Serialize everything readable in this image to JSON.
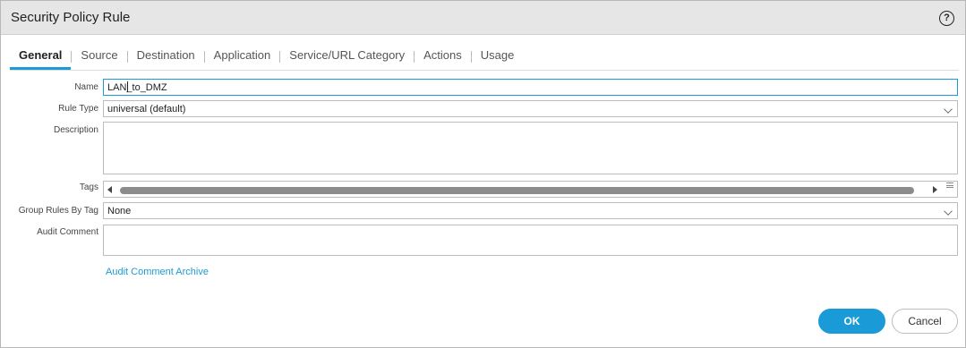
{
  "dialog": {
    "title": "Security Policy Rule",
    "help_icon": "?"
  },
  "tabs": [
    {
      "label": "General",
      "active": true
    },
    {
      "label": "Source"
    },
    {
      "label": "Destination"
    },
    {
      "label": "Application"
    },
    {
      "label": "Service/URL Category"
    },
    {
      "label": "Actions"
    },
    {
      "label": "Usage"
    }
  ],
  "form": {
    "name_label": "Name",
    "name_value": "LAN_to_DMZ",
    "rule_type_label": "Rule Type",
    "rule_type_value": "universal (default)",
    "description_label": "Description",
    "description_value": "",
    "tags_label": "Tags",
    "group_rules_label": "Group Rules By Tag",
    "group_rules_value": "None",
    "audit_comment_label": "Audit Comment",
    "audit_comment_value": "",
    "audit_archive_link": "Audit Comment Archive"
  },
  "buttons": {
    "ok": "OK",
    "cancel": "Cancel"
  },
  "colors": {
    "accent": "#1a9bd7",
    "titlebar": "#e6e6e6"
  }
}
